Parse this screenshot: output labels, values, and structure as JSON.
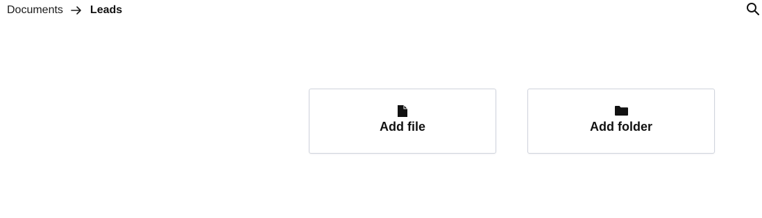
{
  "breadcrumb": {
    "parent": "Documents",
    "separator_icon": "arrow-right-icon",
    "current": "Leads"
  },
  "toolbar": {
    "search_icon": "search-icon"
  },
  "actions": {
    "add_file": {
      "label": "Add file",
      "icon": "file-icon"
    },
    "add_folder": {
      "label": "Add folder",
      "icon": "folder-icon"
    }
  },
  "colors": {
    "text": "#111111",
    "card_border": "#cfd3dc",
    "background": "#ffffff"
  }
}
